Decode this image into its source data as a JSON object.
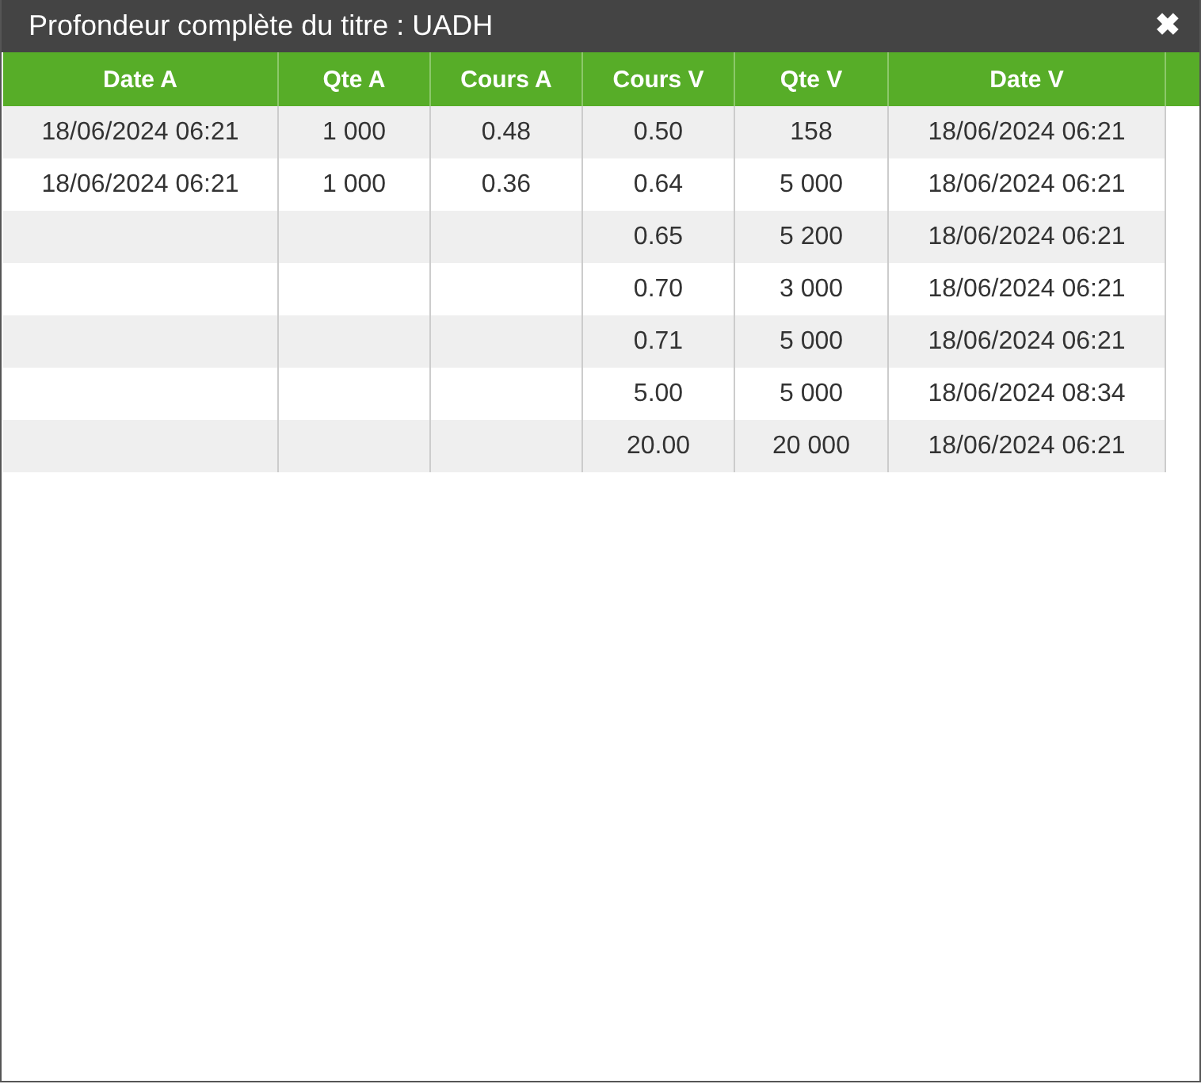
{
  "window": {
    "title": "Profondeur complète du titre : UADH",
    "close": "✖"
  },
  "table": {
    "columns": [
      "Date A",
      "Qte A",
      "Cours A",
      "Cours V",
      "Qte V",
      "Date V"
    ],
    "rows": [
      [
        "18/06/2024 06:21",
        "1 000",
        "0.48",
        "0.50",
        "158",
        "18/06/2024 06:21"
      ],
      [
        "18/06/2024 06:21",
        "1 000",
        "0.36",
        "0.64",
        "5 000",
        "18/06/2024 06:21"
      ],
      [
        null,
        null,
        null,
        "0.65",
        "5 200",
        "18/06/2024 06:21"
      ],
      [
        null,
        null,
        null,
        "0.70",
        "3 000",
        "18/06/2024 06:21"
      ],
      [
        null,
        null,
        null,
        "0.71",
        "5 000",
        "18/06/2024 06:21"
      ],
      [
        null,
        null,
        null,
        "5.00",
        "5 000",
        "18/06/2024 08:34"
      ],
      [
        null,
        null,
        null,
        "20.00",
        "20 000",
        "18/06/2024 06:21"
      ]
    ]
  }
}
